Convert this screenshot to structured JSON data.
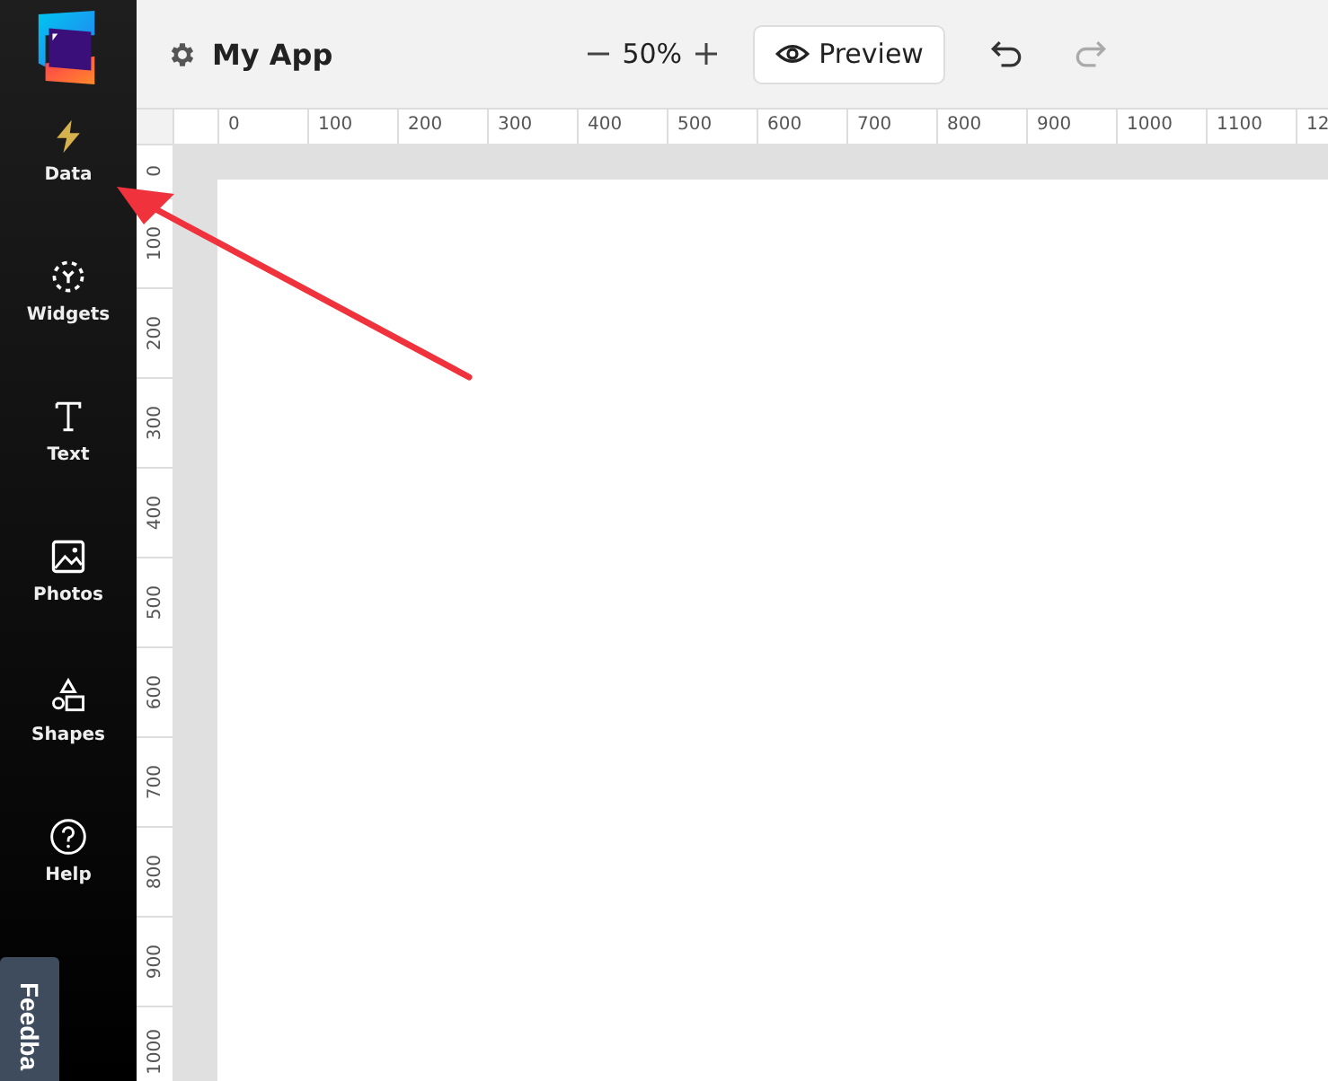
{
  "sidebar": {
    "items": [
      {
        "kind": "data",
        "label": "Data",
        "selected": true
      },
      {
        "kind": "widgets",
        "label": "Widgets",
        "selected": false
      },
      {
        "kind": "text",
        "label": "Text",
        "selected": false
      },
      {
        "kind": "photos",
        "label": "Photos",
        "selected": false
      },
      {
        "kind": "shapes",
        "label": "Shapes",
        "selected": false
      },
      {
        "kind": "help",
        "label": "Help",
        "selected": false
      }
    ],
    "feedback_tab": {
      "label": "Feedba"
    }
  },
  "toolbar": {
    "title": "My App",
    "zoom": "50%",
    "preview": "Preview",
    "undo": {
      "disabled": false
    },
    "redo": {
      "disabled": true
    }
  },
  "rulers": {
    "horizontal": [
      "0",
      "100",
      "200",
      "300",
      "400",
      "500",
      "600",
      "700",
      "800",
      "900",
      "1000",
      "1100",
      "12"
    ],
    "vertical": [
      "0",
      "100",
      "200",
      "300",
      "400",
      "500",
      "600",
      "700",
      "800",
      "900",
      "1000"
    ]
  }
}
